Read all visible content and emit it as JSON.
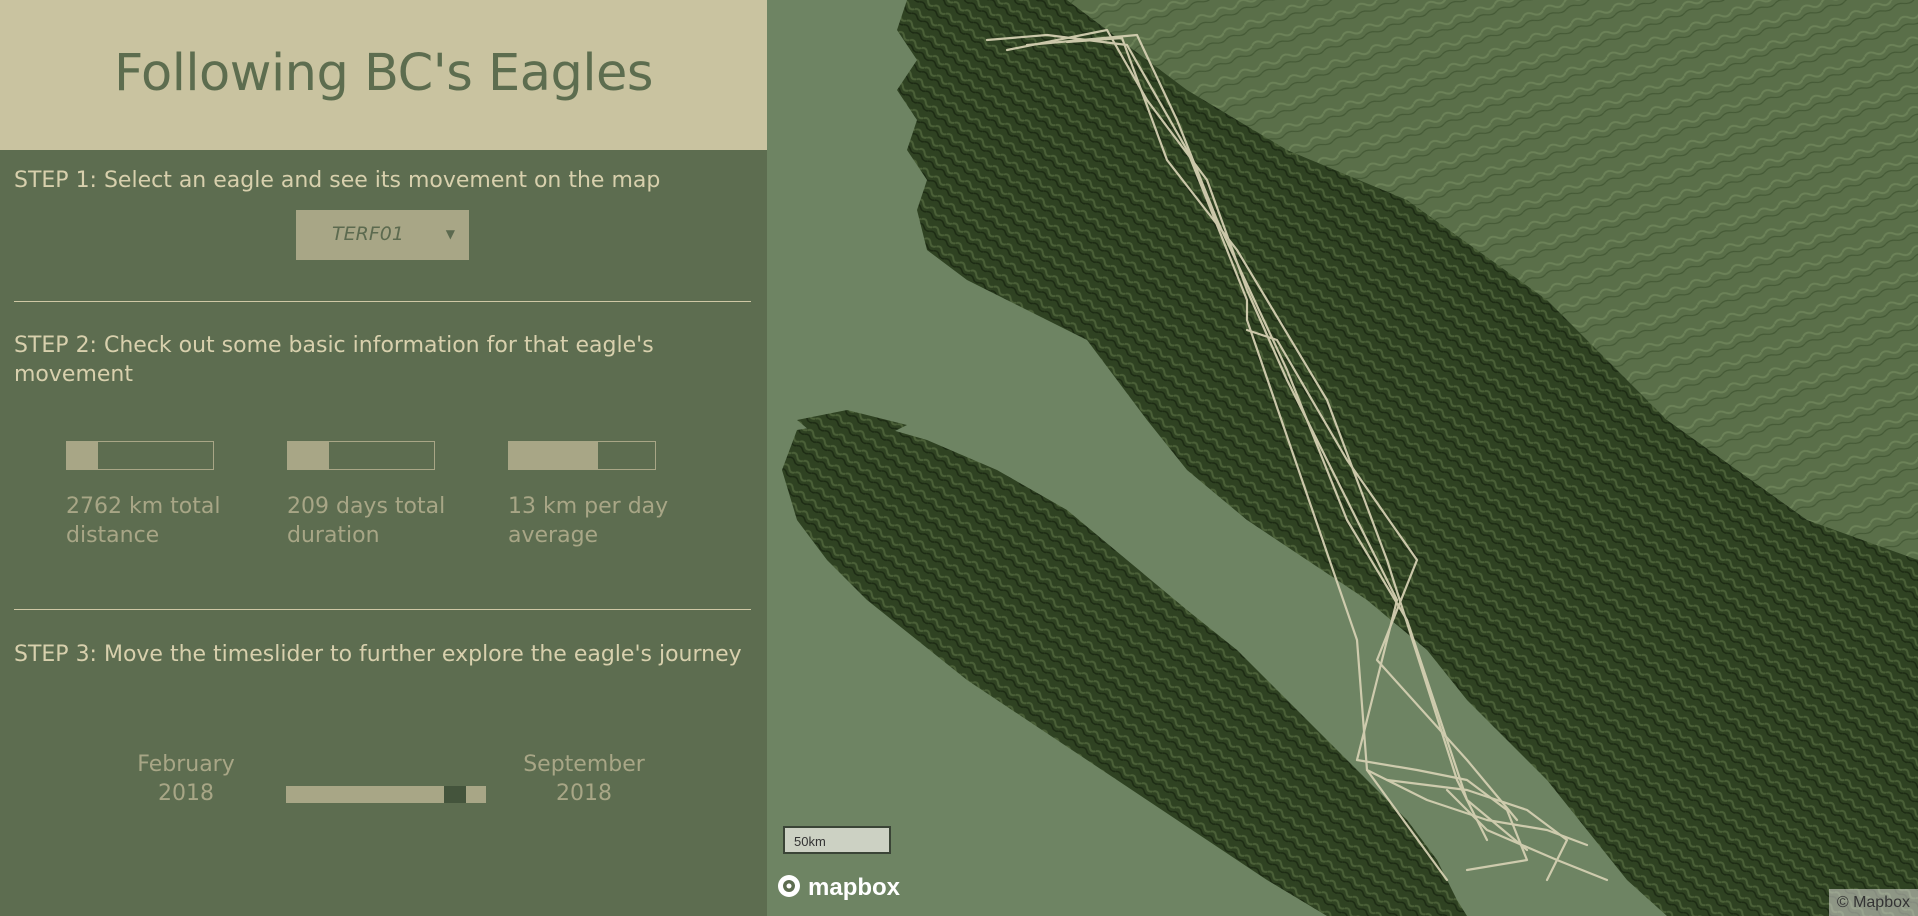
{
  "header": {
    "title": "Following BC's Eagles"
  },
  "step1": {
    "heading": "STEP 1: Select an eagle and see its movement on the map"
  },
  "eagle_select": {
    "selected": "TERF01",
    "caret": "▼"
  },
  "step2": {
    "heading": "STEP 2: Check out some basic information for that eagle's movement"
  },
  "stats": [
    {
      "label": "2762 km total distance",
      "fill_fraction": 0.21
    },
    {
      "label": "209 days total duration",
      "fill_fraction": 0.28
    },
    {
      "label": "13 km per day average",
      "fill_fraction": 0.61
    }
  ],
  "step3": {
    "heading": "STEP 3: Move the timeslider to further explore the eagle's journey"
  },
  "timeslider": {
    "start_label": "February 2018",
    "end_label": "September 2018",
    "position_fraction": 0.89
  },
  "map": {
    "scale_label": "50km",
    "logo_text": "mapbox",
    "logo_icon": "mapbox-logo-icon",
    "attribution": "© Mapbox",
    "track_color": "#d4cfb1",
    "land_color": "#2d3e20",
    "water_color": "#6e8463"
  },
  "colors": {
    "sidebar_bg": "#5d6d50",
    "header_bg": "#c9c3a0",
    "accent": "#a8a686"
  }
}
